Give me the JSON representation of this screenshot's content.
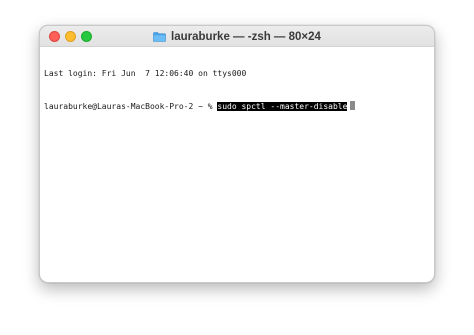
{
  "window": {
    "title": "lauraburke — -zsh — 80×24"
  },
  "terminal": {
    "last_login": "Last login: Fri Jun  7 12:06:40 on ttys000",
    "prompt": "lauraburke@Lauras-MacBook-Pro-2 ~ % ",
    "command": "sudo spctl --master-disable"
  },
  "colors": {
    "close": "#fe5f57",
    "minimize": "#febc2e",
    "maximize": "#28c840",
    "folder": "#4aa3e8",
    "selection_bg": "#000000"
  },
  "icons": {
    "title_icon": "folder-icon"
  }
}
